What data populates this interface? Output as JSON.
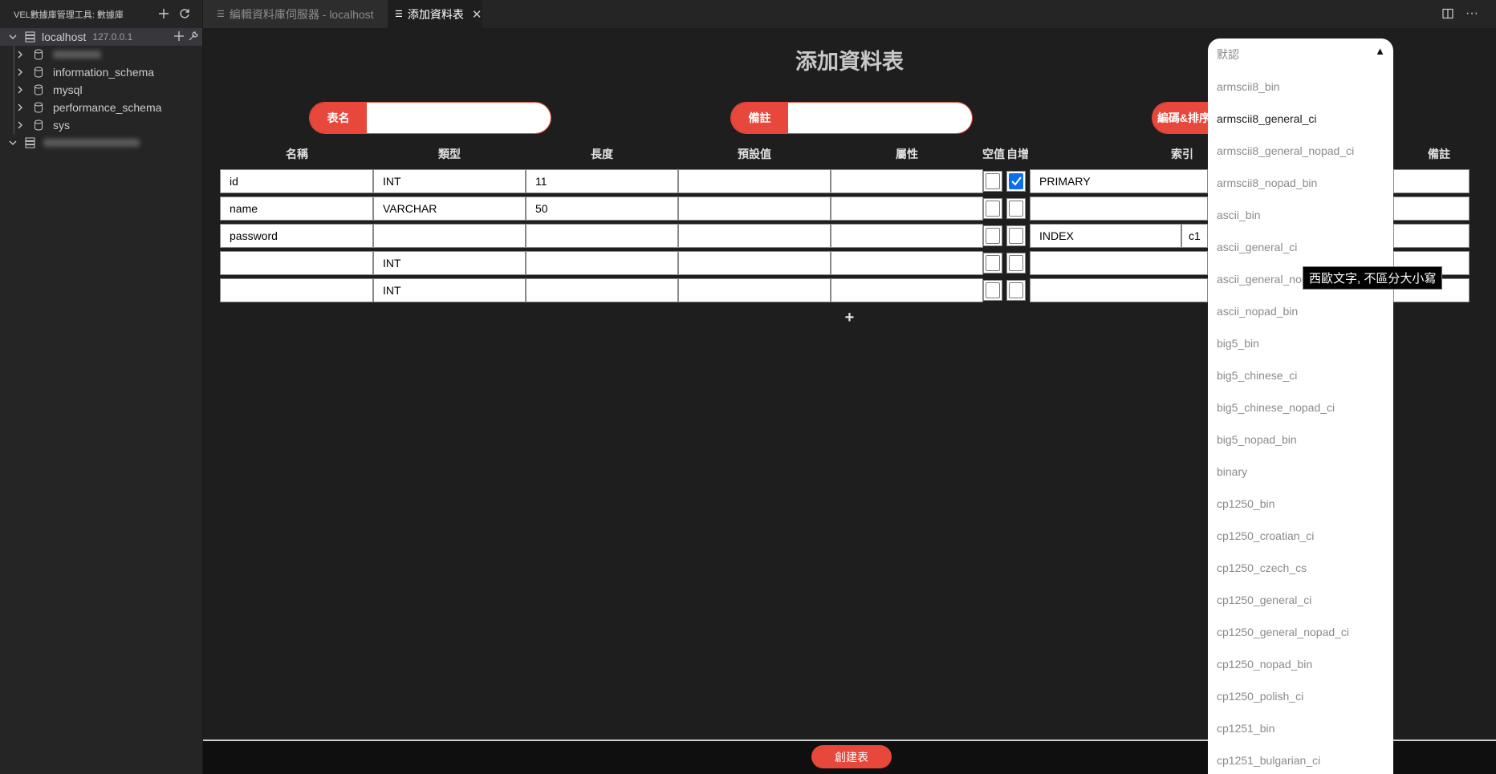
{
  "sidebar": {
    "title": "VEL數據庫管理工具: 數據庫",
    "connection": {
      "name": "localhost",
      "host": "127.0.0.1"
    },
    "databases": [
      "",
      "information_schema",
      "mysql",
      "performance_schema",
      "sys"
    ]
  },
  "tabs": [
    {
      "label": "編輯資料庫伺服器 - localhost"
    },
    {
      "label": "添加資料表"
    }
  ],
  "page": {
    "title": "添加資料表"
  },
  "form": {
    "table_name_label": "表名",
    "table_name_value": "",
    "comment_label": "備註",
    "comment_value": "",
    "charset_label": "編碼&排序"
  },
  "columns": {
    "headers": [
      "名稱",
      "類型",
      "長度",
      "預設值",
      "屬性",
      "空值",
      "自增",
      "索引",
      "備註"
    ],
    "rows": [
      {
        "name": "id",
        "type": "INT",
        "length": "11",
        "default": "",
        "attr": "",
        "nullable": false,
        "auto_inc": true,
        "index": "PRIMARY",
        "index_name": ""
      },
      {
        "name": "name",
        "type": "VARCHAR",
        "length": "50",
        "default": "",
        "attr": "",
        "nullable": false,
        "auto_inc": false,
        "index": "",
        "index_name": ""
      },
      {
        "name": "password",
        "type": "",
        "length": "",
        "default": "",
        "attr": "",
        "nullable": false,
        "auto_inc": false,
        "index": "INDEX",
        "index_name": "c1"
      },
      {
        "name": "",
        "type": "INT",
        "length": "",
        "default": "",
        "attr": "",
        "nullable": false,
        "auto_inc": false,
        "index": "",
        "index_name": ""
      },
      {
        "name": "",
        "type": "INT",
        "length": "",
        "default": "",
        "attr": "",
        "nullable": false,
        "auto_inc": false,
        "index": "",
        "index_name": ""
      }
    ],
    "add_row_label": "+"
  },
  "footer": {
    "create_label": "創建表"
  },
  "collation_dropdown": {
    "selected": "armscii8_general_ci",
    "options": [
      "默認",
      "armscii8_bin",
      "armscii8_general_ci",
      "armscii8_general_nopad_ci",
      "armscii8_nopad_bin",
      "ascii_bin",
      "ascii_general_ci",
      "ascii_general_nopad_ci",
      "ascii_nopad_bin",
      "big5_bin",
      "big5_chinese_ci",
      "big5_chinese_nopad_ci",
      "big5_nopad_bin",
      "binary",
      "cp1250_bin",
      "cp1250_croatian_ci",
      "cp1250_czech_cs",
      "cp1250_general_ci",
      "cp1250_general_nopad_ci",
      "cp1250_nopad_bin",
      "cp1250_polish_ci",
      "cp1251_bin",
      "cp1251_bulgarian_ci"
    ]
  },
  "tooltip": {
    "text": "西歐文字, 不區分大小寫"
  },
  "colors": {
    "accent": "#e8473b",
    "checkbox_on": "#0b6ff0",
    "background": "#1e1e1e",
    "sidebar": "#252526"
  }
}
